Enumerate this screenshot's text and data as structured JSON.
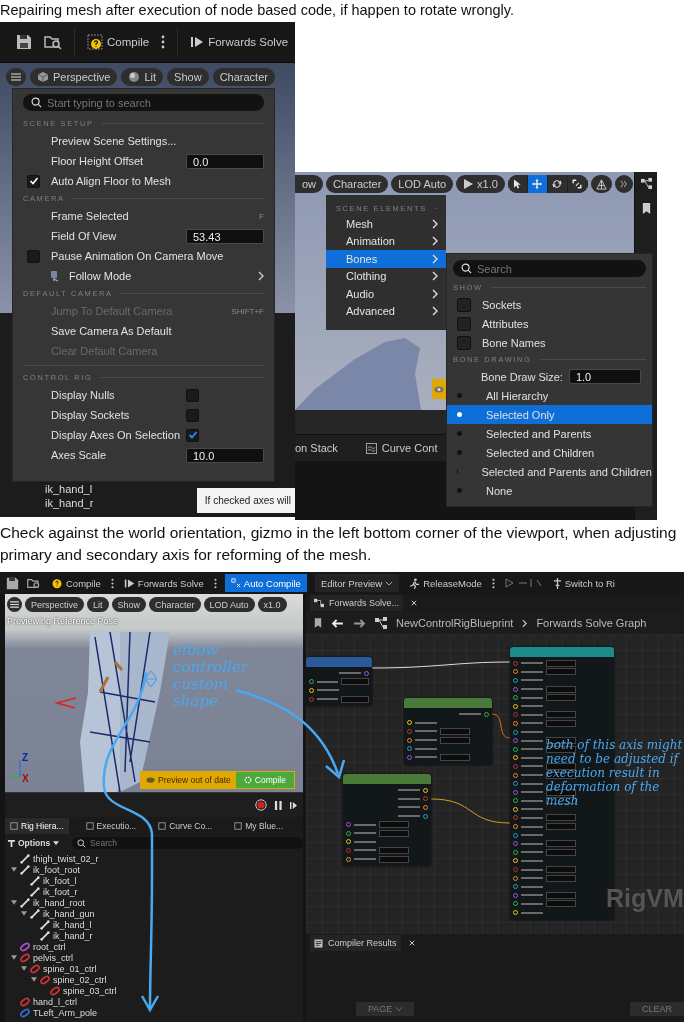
{
  "caption_top": "Repairing mesh after execution of node based code, if happen to rotate wrongly.",
  "shot_a": {
    "toolbar": {
      "compile": "Compile",
      "solve": "Forwards Solve"
    },
    "view_buttons": [
      "Perspective",
      "Lit",
      "Show",
      "Character"
    ],
    "menu": {
      "search_placeholder": "Start typing to search",
      "sections": [
        {
          "title": "SCENE SETUP",
          "items": [
            {
              "kind": "action",
              "label": "Preview Scene Settings...",
              "disabled": false
            },
            {
              "kind": "number",
              "label": "Floor Height Offset",
              "value": "0.0",
              "disabled": false
            },
            {
              "kind": "check",
              "label": "Auto Align Floor to Mesh",
              "checked": true,
              "disabled": false
            }
          ]
        },
        {
          "title": "CAMERA",
          "items": [
            {
              "kind": "action",
              "label": "Frame Selected",
              "shortcut": "F",
              "disabled": false
            },
            {
              "kind": "number",
              "label": "Field Of View",
              "value": "53.43",
              "disabled": false
            },
            {
              "kind": "check",
              "label": "Pause Animation On Camera Move",
              "checked": false,
              "disabled": false
            },
            {
              "kind": "submenu",
              "label": "Follow Mode",
              "disabled": false
            }
          ]
        },
        {
          "title": "DEFAULT CAMERA",
          "items": [
            {
              "kind": "action",
              "label": "Jump To Default Camera",
              "shortcut": "SHIFT+F",
              "disabled": true
            },
            {
              "kind": "action",
              "label": "Save Camera As Default",
              "disabled": false
            },
            {
              "kind": "action",
              "label": "Clear Default Camera",
              "disabled": true
            }
          ]
        },
        {
          "title": "CONTROL RIG",
          "items": [
            {
              "kind": "toggle",
              "label": "Display Nulls",
              "checked": false,
              "disabled": false
            },
            {
              "kind": "toggle",
              "label": "Display Sockets",
              "checked": false,
              "disabled": false
            },
            {
              "kind": "toggle",
              "label": "Display Axes On Selection",
              "checked": true,
              "disabled": false
            },
            {
              "kind": "number",
              "label": "Axes Scale",
              "value": "10.0",
              "disabled": false
            }
          ]
        }
      ]
    },
    "tree_items": [
      "ik_hand_l",
      "ik_hand_r"
    ],
    "tooltip": "If checked axes will"
  },
  "shot_b": {
    "toolbar": [
      "ow",
      "Character",
      "LOD Auto"
    ],
    "speed": "x1.0",
    "tools": [
      {
        "kind": "select",
        "selected": false
      },
      {
        "kind": "move",
        "selected": true
      },
      {
        "kind": "rotate",
        "selected": false
      },
      {
        "kind": "scale",
        "selected": false
      }
    ],
    "menu": {
      "title": "SCENE ELEMENTS",
      "items": [
        {
          "label": "Mesh",
          "selected": false
        },
        {
          "label": "Animation",
          "selected": false
        },
        {
          "label": "Bones",
          "selected": true
        },
        {
          "label": "Clothing",
          "selected": false
        },
        {
          "label": "Audio",
          "selected": false
        },
        {
          "label": "Advanced",
          "selected": false
        }
      ]
    },
    "submenu": {
      "search_placeholder": "Search",
      "show_title": "SHOW",
      "checks": [
        {
          "label": "Sockets",
          "checked": false
        },
        {
          "label": "Attributes",
          "checked": false
        },
        {
          "label": "Bone Names",
          "checked": false
        }
      ],
      "drawing_title": "BONE DRAWING",
      "size_label": "Bone Draw Size:",
      "size_value": "1.0",
      "options": [
        {
          "label": "All Hierarchy",
          "selected": false
        },
        {
          "label": "Selected Only",
          "selected": true
        },
        {
          "label": "Selected and Parents",
          "selected": false
        },
        {
          "label": "Selected and Children",
          "selected": false
        },
        {
          "label": "Selected and Parents and Children",
          "selected": false
        },
        {
          "label": "None",
          "selected": false
        }
      ]
    },
    "panel_tabs": [
      "on Stack",
      "Curve Cont"
    ]
  },
  "caption_middle": "Check against the world orientation, gizmo in the left bottom corner of the viewport, when adjusting primary and secondary axis for reforming of the mesh.",
  "shot_c": {
    "toolbar": {
      "compile": "Compile",
      "solve": "Forwards Solve",
      "auto_compile": "Auto Compile",
      "preview": "Editor Preview",
      "release": "ReleaseMode",
      "switch": "Switch to Ri"
    },
    "viewport": {
      "buttons": [
        "Perspective",
        "Lit",
        "Show",
        "Character",
        "LOD Auto",
        "x1.0"
      ],
      "status": "Previewing Reference Pose",
      "gizmo": [
        "Z",
        "X"
      ],
      "warning": "Preview out of date",
      "compile": "Compile",
      "note": "elbow controller custom shape"
    },
    "panel": {
      "tabs": [
        {
          "label": "Rig Hiera...",
          "selected": true
        },
        {
          "label": "Executio...",
          "selected": false
        },
        {
          "label": "Curve Co...",
          "selected": false
        },
        {
          "label": "My Blue...",
          "selected": false
        }
      ],
      "options": "Options",
      "search_placeholder": "Search",
      "tree": [
        {
          "label": "thigh_twist_02_r",
          "kind": "bone"
        },
        {
          "label": "ik_foot_root",
          "kind": "bone",
          "children": [
            {
              "label": "ik_foot_l",
              "kind": "bone"
            },
            {
              "label": "ik_foot_r",
              "kind": "bone"
            }
          ]
        },
        {
          "label": "ik_hand_root",
          "kind": "bone",
          "children": [
            {
              "label": "ik_hand_gun",
              "kind": "bone",
              "children": [
                {
                  "label": "ik_hand_l",
                  "kind": "bone"
                },
                {
                  "label": "ik_hand_r",
                  "kind": "bone"
                }
              ]
            }
          ]
        },
        {
          "label": "root_ctrl",
          "kind": "control",
          "color": "#b04fd0"
        },
        {
          "label": "pelvis_ctrl",
          "kind": "control",
          "color": "#d03434",
          "children": [
            {
              "label": "spine_01_ctrl",
              "kind": "control",
              "color": "#d03434",
              "children": [
                {
                  "label": "spine_02_ctrl",
                  "kind": "control",
                  "color": "#d03434",
                  "children": [
                    {
                      "label": "spine_03_ctrl",
                      "kind": "control",
                      "color": "#d03434"
                    }
                  ]
                }
              ]
            }
          ]
        },
        {
          "label": "hand_l_ctrl",
          "kind": "control",
          "color": "#d03434"
        },
        {
          "label": "TLeft_Arm_pole",
          "kind": "control",
          "color": "#3a6ad8"
        }
      ]
    },
    "graph": {
      "tab": "Forwards Solve...",
      "path": [
        "NewControlRigBlueprint",
        "Forwards Solve Graph"
      ],
      "note": "both of this axis might need to be adjusted if execution result in deformation of the mesh",
      "watermark": "RigVM"
    },
    "compiler": {
      "tab": "Compiler Results",
      "page": "PAGE",
      "clear": "CLEAR"
    }
  }
}
